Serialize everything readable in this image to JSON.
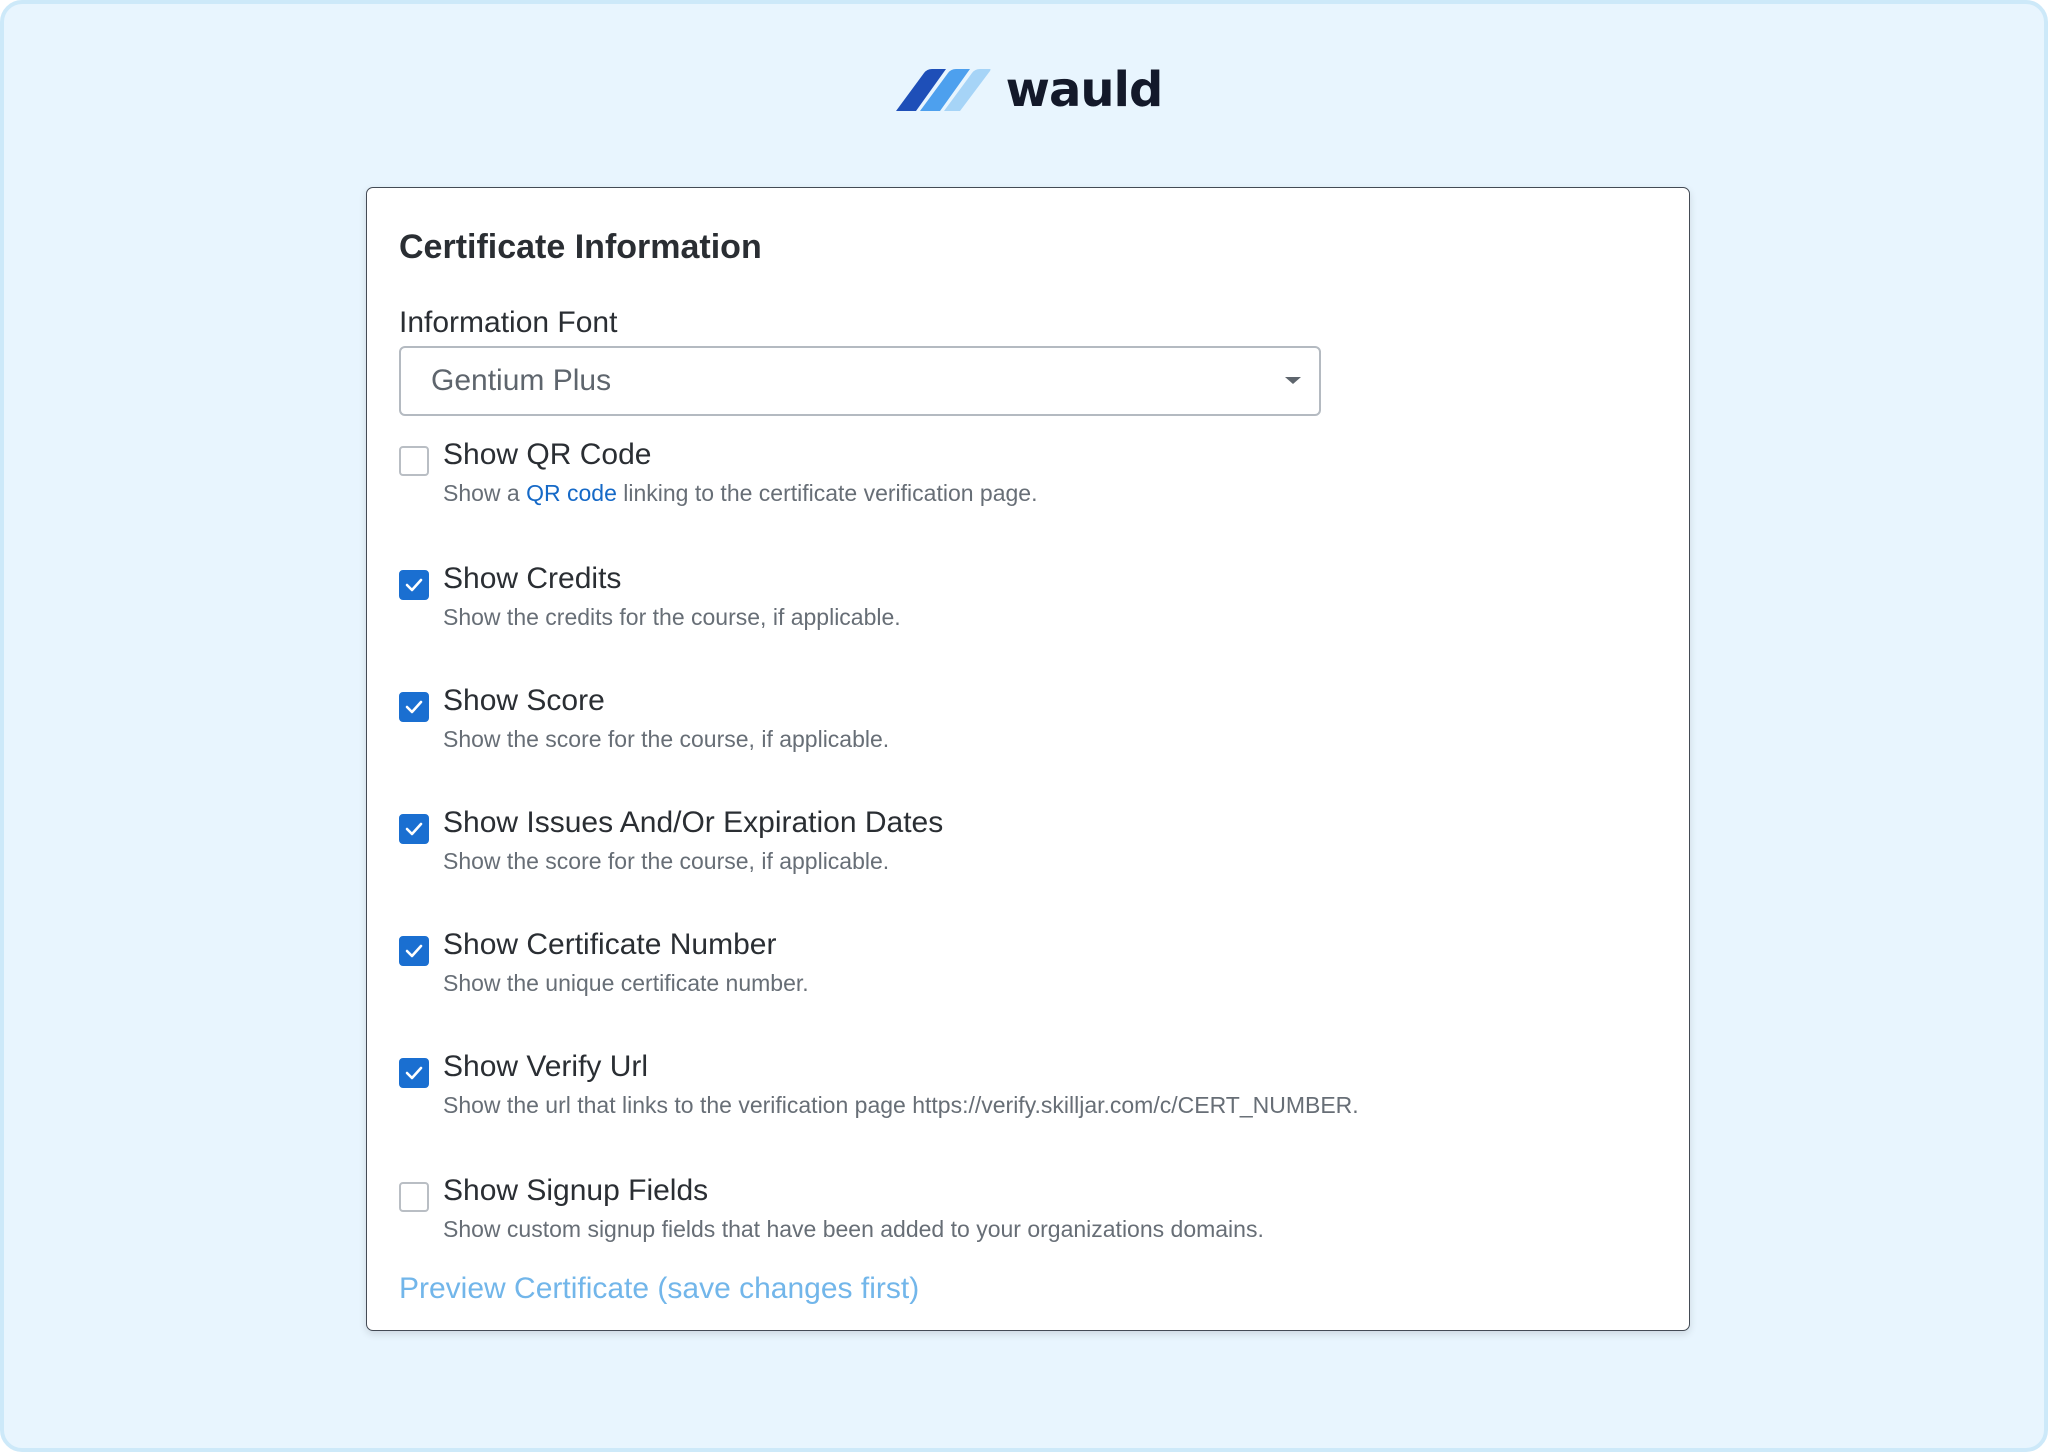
{
  "brand": {
    "name": "wauld",
    "colors": {
      "dark": "#1e4fb8",
      "mid": "#4da0ee",
      "light": "#a6d4f7"
    }
  },
  "panel": {
    "title": "Certificate Information",
    "font_label": "Information Font",
    "font_value": "Gentium Plus",
    "font_icon": "chevron-down-icon"
  },
  "options": [
    {
      "title": "Show QR Code",
      "checked": false,
      "desc_before": "Show a ",
      "desc_link": "QR code",
      "desc_after": " linking to the certificate verification page."
    },
    {
      "title": "Show Credits",
      "checked": true,
      "desc": "Show the credits for the course, if applicable."
    },
    {
      "title": "Show Score",
      "checked": true,
      "desc": "Show the score for the course, if applicable."
    },
    {
      "title": "Show Issues And/Or Expiration Dates",
      "checked": true,
      "desc": "Show the score for the course, if applicable."
    },
    {
      "title": "Show Certificate Number",
      "checked": true,
      "desc": "Show the unique certificate number."
    },
    {
      "title": "Show Verify Url",
      "checked": true,
      "desc": "Show the url that links to the verification page https://verify.skilljar.com/c/CERT_NUMBER."
    },
    {
      "title": "Show Signup Fields",
      "checked": false,
      "desc": "Show custom signup fields that have been added to your organizations domains."
    }
  ],
  "preview_link": "Preview Certificate (save changes first)",
  "colors": {
    "accent": "#1a6fd1",
    "link": "#1569c7",
    "preview_link": "#72b6ea",
    "background": "#e8f5fe"
  }
}
